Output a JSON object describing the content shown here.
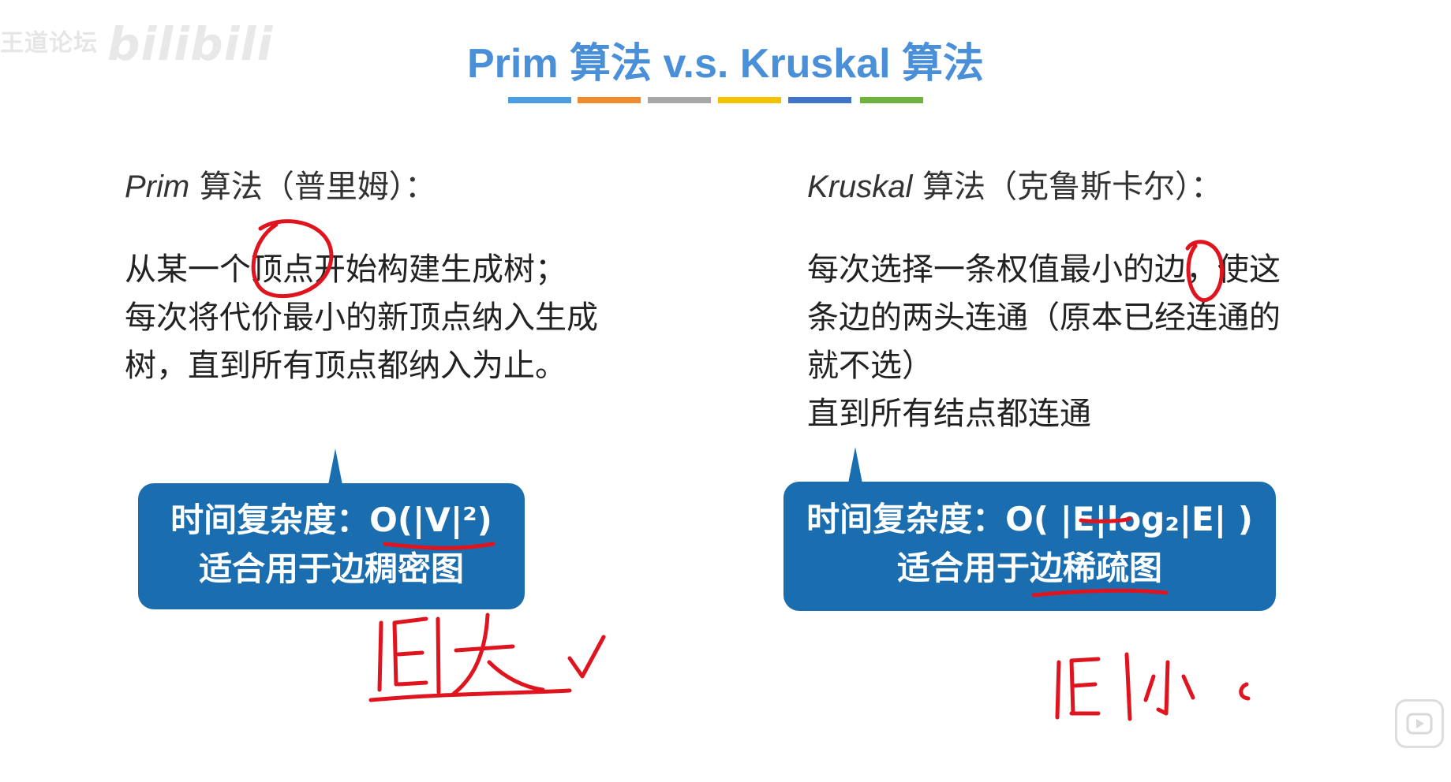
{
  "watermark": {
    "text": "王道论坛",
    "logo": "bilibili"
  },
  "slide": {
    "title": "Prim 算法 v.s. Kruskal 算法",
    "color_bar": [
      "#4a9fe0",
      "#ef8a2e",
      "#a7a7a7",
      "#f2c100",
      "#3f74c8",
      "#6fb33f"
    ]
  },
  "prim": {
    "heading_en": "Prim",
    "heading_zh": " 算法（普里姆）：",
    "lines": [
      "从某一个顶点开始构建生成树；",
      "每次将代价最小的新顶点纳入生成",
      "树，直到所有顶点都纳入为止。"
    ],
    "complexity_label": "时间复杂度：",
    "complexity_formula": "O(|V|²)",
    "usage": "适合用于边稠密图",
    "handwritten_note": "|E|大✓"
  },
  "kruskal": {
    "heading_en": "Kruskal",
    "heading_zh": " 算法（克鲁斯卡尔）：",
    "lines": [
      "每次选择一条权值最小的边，使这",
      "条边的两头连通（原本已经连通的",
      "就不选）",
      "直到所有结点都连通"
    ],
    "complexity_label": "时间复杂度：",
    "complexity_formula": "O( |E|log₂|E| )",
    "usage": "适合用于边稀疏图",
    "handwritten_note": "|E|小"
  },
  "colors": {
    "title": "#4a90d9",
    "bubble": "#1a6eb0",
    "ink": "#e0141e"
  },
  "icons": {
    "player": "play-icon"
  }
}
